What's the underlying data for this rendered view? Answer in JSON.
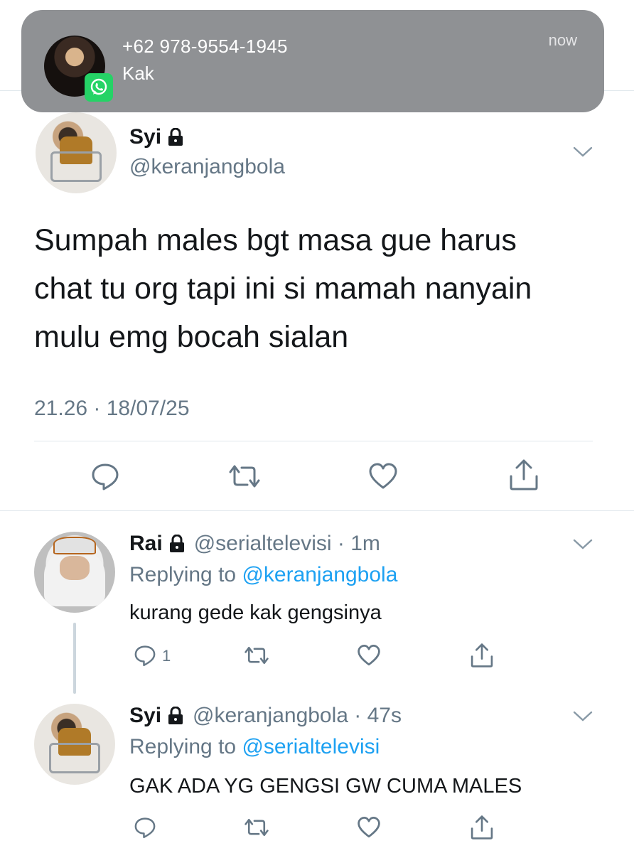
{
  "notification": {
    "title": "+62 978-9554-1945",
    "body": "Kak",
    "time": "now",
    "app_icon": "whatsapp-icon"
  },
  "main_tweet": {
    "name": "Syi",
    "locked_icon": "lock-icon",
    "handle": "@keranjangbola",
    "text_lines": [
      "Sumpah males bgt masa gue harus",
      "chat tu org tapi ini si mamah nanyain",
      "mulu emg bocah sialan"
    ],
    "timestamp": "21.26 · 18/07/25",
    "actions": [
      "reply-icon",
      "retweet-icon",
      "like-icon",
      "share-icon"
    ]
  },
  "replies": [
    {
      "name": "Rai",
      "handle_time": "@serialtelevisi · 1m",
      "replying_prefix": "Replying to ",
      "replying_to": "@keranjangbola",
      "text": "kurang gede kak gengsinya",
      "reply_count": "1"
    },
    {
      "name": "Syi",
      "handle_time": "@keranjangbola · 47s",
      "replying_prefix": "Replying to ",
      "replying_to": "@serialtelevisi",
      "text": "GAK ADA YG GENGSI GW CUMA MALES",
      "reply_count": ""
    }
  ],
  "colors": {
    "accent": "#1da1f2",
    "secondary_text": "#657786",
    "notification_bg": "#8f9194",
    "whatsapp": "#25d366"
  }
}
